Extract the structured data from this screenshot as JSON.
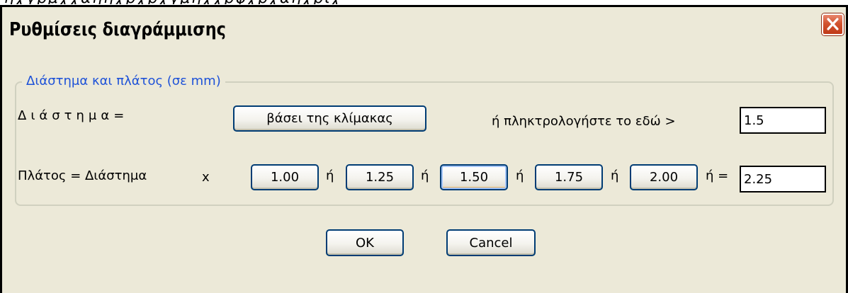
{
  "dialog": {
    "title": "Ρυθμίσεις διαγράμμισης",
    "close_icon": "close-icon"
  },
  "group": {
    "legend": "Διάστημα και πλάτος (σε mm)"
  },
  "spacing": {
    "label": "Διάστημα=",
    "scale_button": "βάσει της κλίμακας",
    "or_type_label": "ή πληκτρολογήστε το εδώ >",
    "value": "1.5"
  },
  "width": {
    "label": "Πλάτος = Διάστημα",
    "times": "x",
    "or": "ή",
    "or_equals": "ή =",
    "options": [
      "1.00",
      "1.25",
      "1.50",
      "1.75",
      "2.00"
    ],
    "value": "2.25"
  },
  "buttons": {
    "ok": "OK",
    "cancel": "Cancel"
  },
  "colors": {
    "dialog_bg": "#ece9d8",
    "legend_text": "#1e52d8",
    "close_button": "#d2532f"
  }
}
